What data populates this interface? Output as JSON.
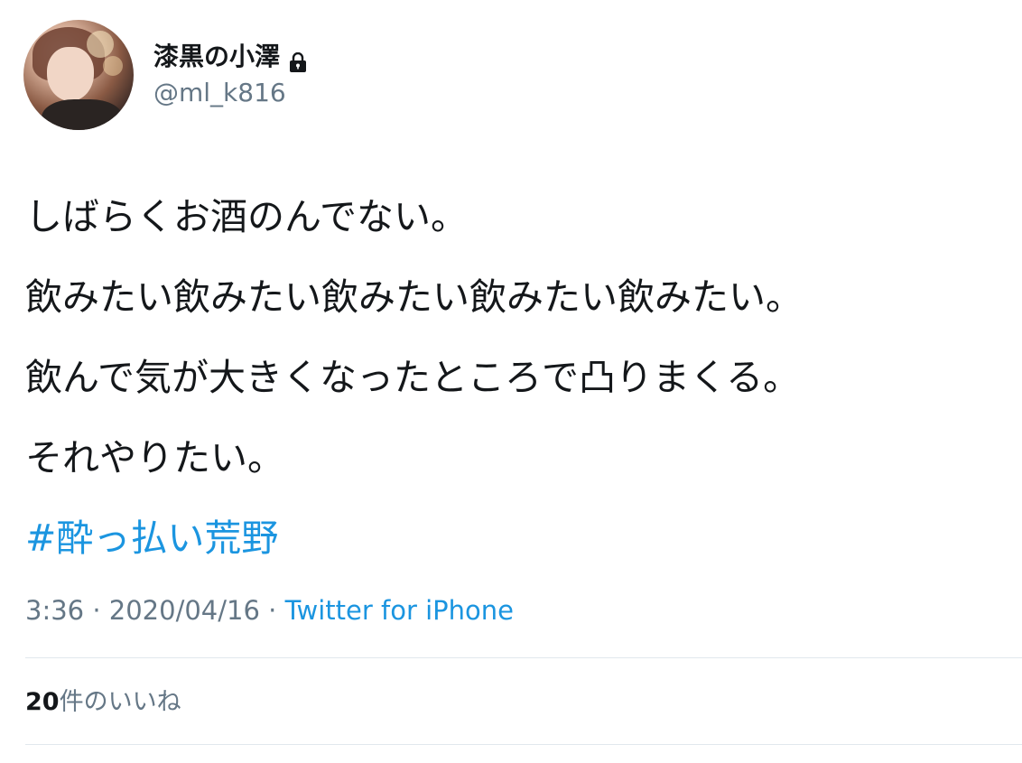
{
  "user": {
    "display_name": "漆黒の小澤",
    "username": "@ml_k816",
    "protected_icon": "lock-icon"
  },
  "tweet": {
    "lines": [
      "しばらくお酒のんでない。",
      "飲みたい飲みたい飲みたい飲みたい飲みたい。",
      "飲んで気が大きくなったところで凸りまくる。",
      "それやりたい。"
    ],
    "hashtag": "#酔っ払い荒野"
  },
  "meta": {
    "time": "3:36",
    "separator": " · ",
    "date": "2020/04/16",
    "source": "Twitter for iPhone"
  },
  "likes": {
    "count": "20",
    "label": "件のいいね"
  },
  "colors": {
    "text": "#14171a",
    "secondary": "#657786",
    "link": "#1b95e0",
    "divider": "#e1e8ed"
  }
}
